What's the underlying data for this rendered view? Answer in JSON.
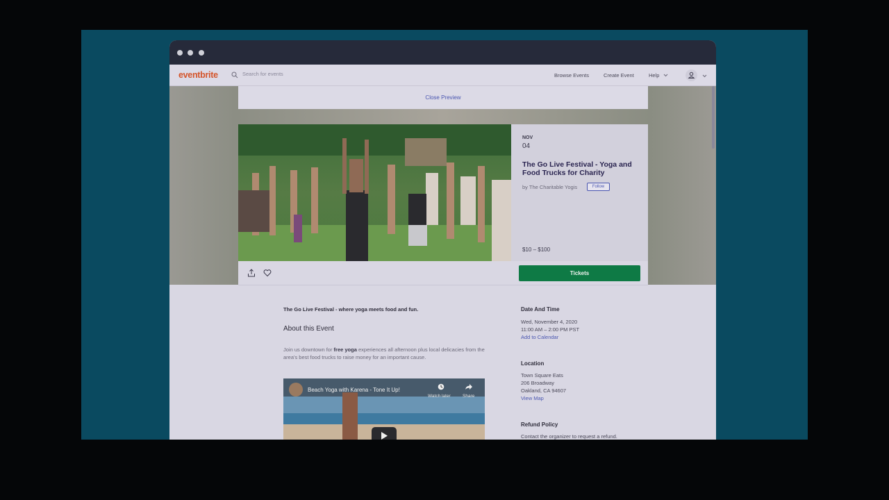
{
  "nav": {
    "logo": "eventbrite",
    "search_placeholder": "Search for events",
    "browse_events": "Browse Events",
    "create_event": "Create Event",
    "help": "Help"
  },
  "preview": {
    "close_label": "Close Preview"
  },
  "event": {
    "month": "NOV",
    "day": "04",
    "title": "The Go Live Festival - Yoga and Food Trucks for Charity",
    "organizer": "by The Charitable Yogis",
    "follow_label": "Follow",
    "price": "$10 – $100",
    "tickets_label": "Tickets"
  },
  "details": {
    "summary": "The Go Live Festival - where yoga meets food and fun.",
    "about_heading": "About this Event",
    "about_pre": "Join us downtown for ",
    "about_bold": "free yoga",
    "about_post": " experiences all afternoon plus local delicacies from the area's best food trucks to raise money for an important cause.",
    "video_title": "Beach Yoga with Karena - Tone It Up!",
    "video_watch_later": "Watch later",
    "video_share": "Share"
  },
  "sidebar": {
    "date_heading": "Date And Time",
    "date_line1": "Wed, November 4, 2020",
    "date_line2": "11:00 AM – 2:00 PM PST",
    "add_calendar": "Add to Calendar",
    "location_heading": "Location",
    "location_line1": "Town Square Eats",
    "location_line2": "206 Broadway",
    "location_line3": "Oakland, CA 94607",
    "view_map": "View Map",
    "refund_heading": "Refund Policy",
    "refund_text": "Contact the organizer to request a refund."
  },
  "colors": {
    "brand": "#d4542a",
    "link": "#4a56b0",
    "tickets_button": "#0e7a45",
    "backdrop": "#0a4a60"
  }
}
